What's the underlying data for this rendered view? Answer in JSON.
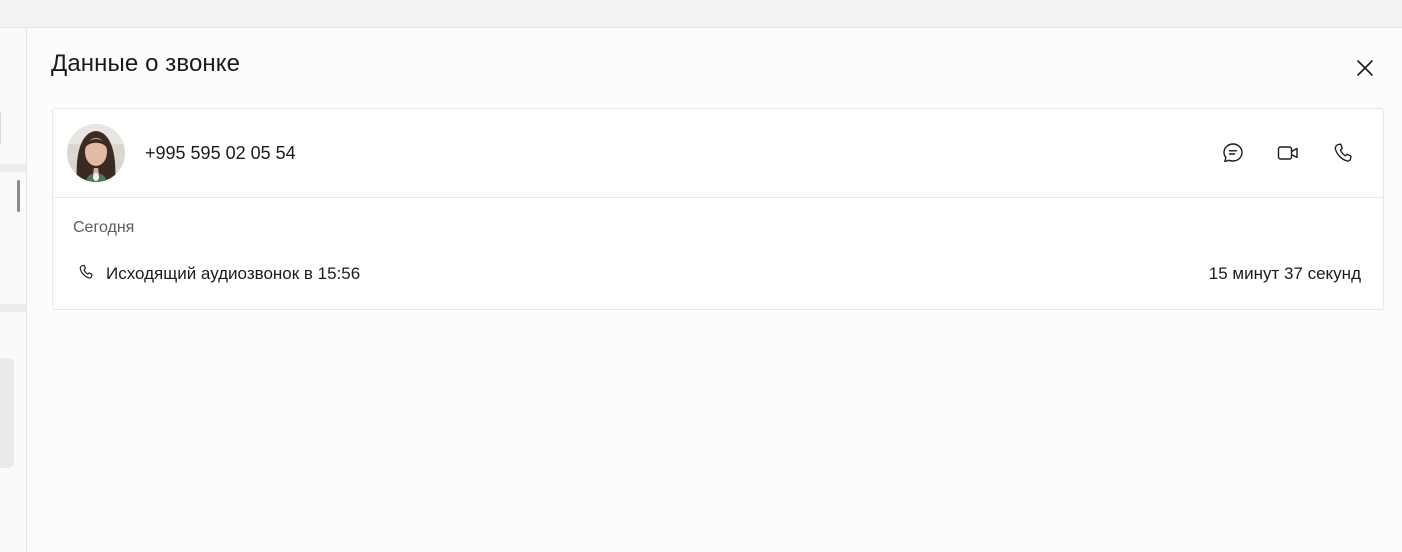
{
  "panel": {
    "title": "Данные о звонке"
  },
  "contact": {
    "phone": "+995 595 02 05 54",
    "avatar_icon": "contact-photo"
  },
  "actions": [
    {
      "name": "chat",
      "icon": "chat-bubble-icon"
    },
    {
      "name": "video",
      "icon": "video-camera-icon"
    },
    {
      "name": "call",
      "icon": "phone-icon"
    }
  ],
  "history": {
    "date_label": "Сегодня",
    "entries": [
      {
        "description": "Исходящий аудиозвонок в 15:56",
        "duration": "15 минут 37 секунд",
        "icon": "phone-icon"
      }
    ]
  },
  "colors": {
    "background": "#fdfcfc",
    "card": "#ffffff",
    "border": "#e7e7e7",
    "text": "#1b1b1b",
    "muted": "#5c5c5c"
  }
}
